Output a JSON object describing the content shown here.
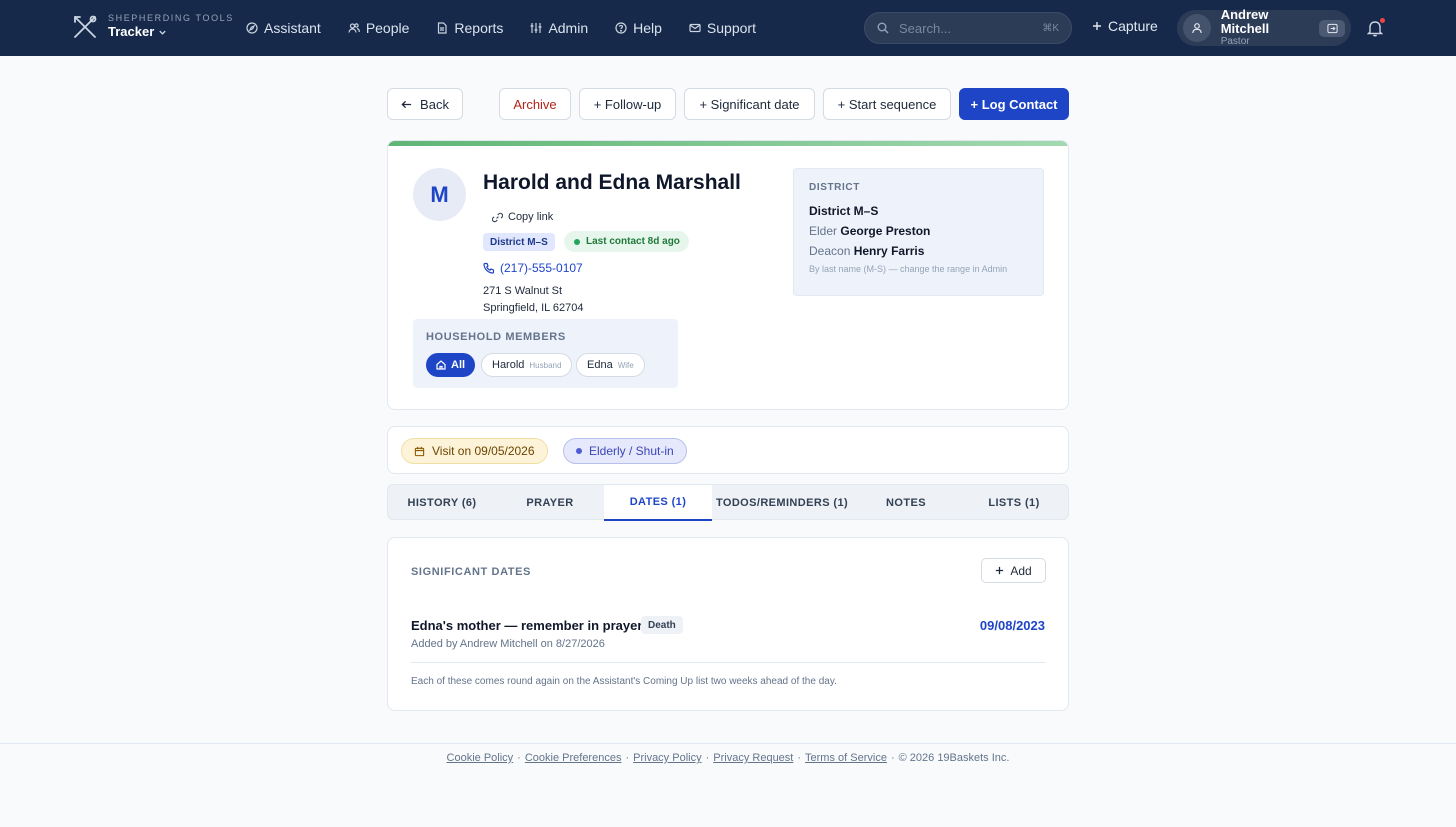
{
  "header": {
    "brand_sub": "SHEPHERDING TOOLS",
    "brand_name": "Tracker",
    "nav": [
      {
        "label": "Assistant",
        "icon": "compass-icon"
      },
      {
        "label": "People",
        "icon": "people-icon"
      },
      {
        "label": "Reports",
        "icon": "document-icon"
      },
      {
        "label": "Admin",
        "icon": "sliders-icon"
      },
      {
        "label": "Help",
        "icon": "help-circle-icon"
      },
      {
        "label": "Support",
        "icon": "mail-icon"
      }
    ],
    "search_placeholder": "Search...",
    "search_shortcut": "⌘K",
    "capture_label": "Capture",
    "user_name": "Andrew Mitchell",
    "user_role": "Pastor"
  },
  "actions": {
    "back": "Back",
    "archive": "Archive",
    "follow_up": "+ Follow-up",
    "significant_date": "+ Significant date",
    "start_sequence": "+ Start sequence",
    "log_contact": "+ Log Contact"
  },
  "profile": {
    "initial": "M",
    "name": "Harold and Edna Marshall",
    "copy_link": "Copy link",
    "district_badge": "District M–S",
    "last_contact": "Last contact 8d ago",
    "phone": "(217)-555-0107",
    "address_line1": "271 S Walnut St",
    "address_line2": "Springfield, IL 62704"
  },
  "district": {
    "label": "DISTRICT",
    "name": "District M–S",
    "elder_label": "Elder",
    "elder_name": "George Preston",
    "deacon_label": "Deacon",
    "deacon_name": "Henry Farris",
    "note": "By last name (M-S) — change the range in Admin"
  },
  "household": {
    "label": "HOUSEHOLD MEMBERS",
    "all_label": "All",
    "members": [
      {
        "name": "Harold",
        "role": "Husband"
      },
      {
        "name": "Edna",
        "role": "Wife"
      }
    ]
  },
  "tags": {
    "visit": "Visit on 09/05/2026",
    "category": "Elderly / Shut-in"
  },
  "tabs": [
    {
      "label": "HISTORY (6)"
    },
    {
      "label": "PRAYER"
    },
    {
      "label": "DATES (1)",
      "active": true
    },
    {
      "label": "TODOS/REMINDERS (1)"
    },
    {
      "label": "NOTES"
    },
    {
      "label": "LISTS (1)"
    }
  ],
  "significant_dates": {
    "label": "SIGNIFICANT DATES",
    "add_label": "Add",
    "items": [
      {
        "title": "Edna's mother — remember in prayer",
        "type": "Death",
        "meta": "Added by Andrew Mitchell on 8/27/2026",
        "date": "09/08/2023"
      }
    ],
    "footnote": "Each of these comes round again on the Assistant's Coming Up list two weeks ahead of the day."
  },
  "footer": {
    "links": [
      "Cookie Policy",
      "Cookie Preferences",
      "Privacy Policy",
      "Privacy Request",
      "Terms of Service"
    ],
    "copyright": "© 2026 19Baskets Inc."
  },
  "colors": {
    "header_bg": "#16294a",
    "primary": "#1f45c7",
    "archive": "#b42318",
    "success": "#22a45a"
  }
}
